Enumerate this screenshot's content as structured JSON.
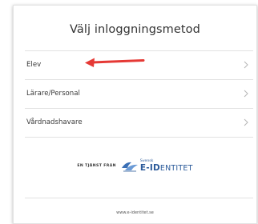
{
  "heading": "Välj inloggningsmetod",
  "options": [
    {
      "label": "Elev",
      "chevron": "chevron-right-icon"
    },
    {
      "label": "Lärare/Personal",
      "chevron": "chevron-right-icon"
    },
    {
      "label": "Vårdnadshavare",
      "chevron": "chevron-right-icon"
    }
  ],
  "annotation": {
    "icon": "red-arrow-icon",
    "color": "#e53935"
  },
  "brand": {
    "prefix": "EN TJÄNST FRÅN",
    "small": "Svensk",
    "big_lead": "E-ID",
    "big_rest": "ENTITET",
    "logo": "e-identitet-logo",
    "color": "#2b5a9a"
  },
  "footer": {
    "url": "www.e-identitet.se"
  }
}
